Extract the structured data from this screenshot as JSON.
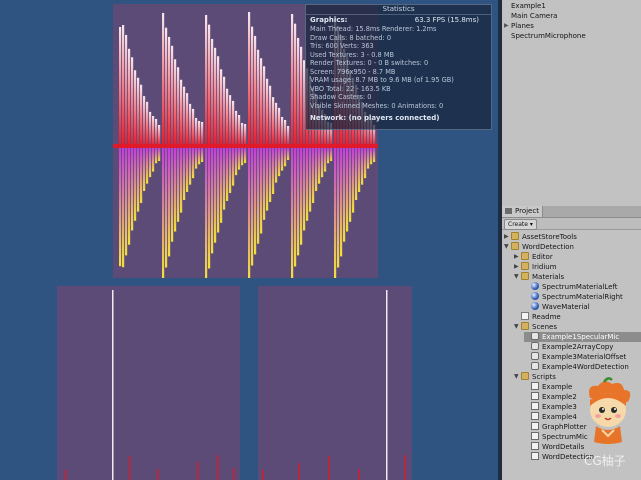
{
  "hierarchy": {
    "items": [
      {
        "label": "Example1",
        "expandable": false
      },
      {
        "label": "Main Camera",
        "expandable": false
      },
      {
        "label": "Planes",
        "expandable": true
      },
      {
        "label": "SpectrumMicrophone",
        "expandable": false
      }
    ]
  },
  "project": {
    "tab_label": "Project",
    "create_label": "Create",
    "tree": [
      {
        "label": "AssetStoreTools",
        "icon": "folder",
        "expand": "▶",
        "indent": 0
      },
      {
        "label": "WordDetection",
        "icon": "folder",
        "expand": "▼",
        "indent": 0
      },
      {
        "label": "Editor",
        "icon": "folder",
        "expand": "▶",
        "indent": 1
      },
      {
        "label": "Iridium",
        "icon": "folder",
        "expand": "▶",
        "indent": 1
      },
      {
        "label": "Materials",
        "icon": "folder",
        "expand": "▼",
        "indent": 1
      },
      {
        "label": "SpectrumMaterialLeft",
        "icon": "material",
        "expand": "",
        "indent": 2
      },
      {
        "label": "SpectrumMaterialRight",
        "icon": "material",
        "expand": "",
        "indent": 2
      },
      {
        "label": "WaveMaterial",
        "icon": "material",
        "expand": "",
        "indent": 2
      },
      {
        "label": "Readme",
        "icon": "doc",
        "expand": "",
        "indent": 1
      },
      {
        "label": "Scenes",
        "icon": "folder",
        "expand": "▼",
        "indent": 1
      },
      {
        "label": "Example1SpecularMic",
        "icon": "scene",
        "expand": "",
        "indent": 2,
        "selected": true
      },
      {
        "label": "Example2ArrayCopy",
        "icon": "scene",
        "expand": "",
        "indent": 2
      },
      {
        "label": "Example3MaterialOffset",
        "icon": "scene",
        "expand": "",
        "indent": 2
      },
      {
        "label": "Example4WordDetection",
        "icon": "scene",
        "expand": "",
        "indent": 2
      },
      {
        "label": "Scripts",
        "icon": "folder",
        "expand": "▼",
        "indent": 1
      },
      {
        "label": "Example",
        "icon": "script",
        "expand": "",
        "indent": 2
      },
      {
        "label": "Example2",
        "icon": "script",
        "expand": "",
        "indent": 2
      },
      {
        "label": "Example3",
        "icon": "script",
        "expand": "",
        "indent": 2
      },
      {
        "label": "Example4",
        "icon": "script",
        "expand": "",
        "indent": 2
      },
      {
        "label": "GraphPlotter",
        "icon": "script",
        "expand": "",
        "indent": 2
      },
      {
        "label": "SpectrumMic",
        "icon": "script",
        "expand": "",
        "indent": 2
      },
      {
        "label": "WordDetails",
        "icon": "script",
        "expand": "",
        "indent": 2
      },
      {
        "label": "WordDetection",
        "icon": "script",
        "expand": "",
        "indent": 2
      }
    ]
  },
  "stats": {
    "title": "Statistics",
    "graphics_label": "Graphics:",
    "fps": "63.3 FPS (15.8ms)",
    "lines": [
      "Main Thread: 15.8ms  Renderer: 1.2ms",
      "Draw Calls: 8  batched: 0",
      "Tris: 600  Verts: 363",
      "Used Textures: 3 - 0.8 MB",
      "Render Textures: 0 - 0 B  switches: 0",
      "Screen: 796x950 - 8.7 MB",
      "VRAM usage: 8.7 MB to 9.6 MB (of 1.95 GB)",
      "VBO Total: 22 - 163.5 KB",
      "Shadow Casters: 0",
      "Visible Skinned Meshes: 0      Animations: 0"
    ],
    "network": "Network: (no players connected)"
  },
  "watermark": "CG柚子",
  "colors": {
    "viewport_bg": "#2f5482",
    "plane": "#5c4a77",
    "spectrum_low": "#e81a2a",
    "spectrum_high": "#f8e6ee",
    "mirror_top": "#c43ddc",
    "mirror_bottom": "#f2e23a"
  }
}
